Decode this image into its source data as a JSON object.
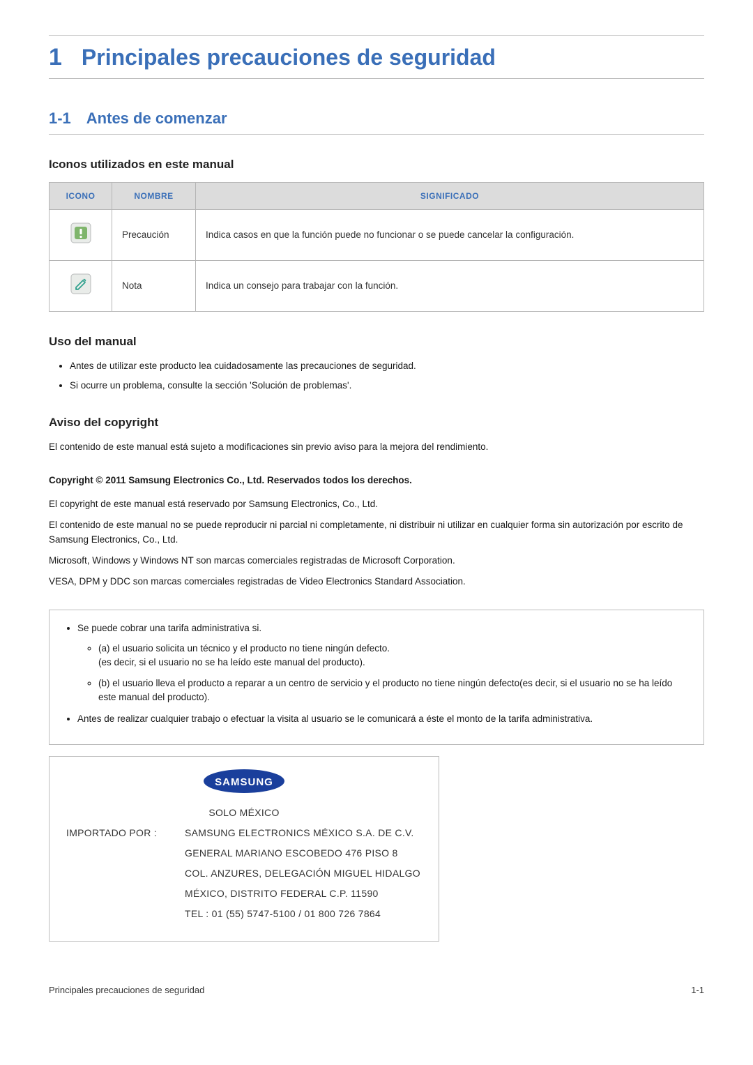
{
  "chapter": {
    "number": "1",
    "title": "Principales precauciones de seguridad"
  },
  "section": {
    "number": "1-1",
    "title": "Antes de comenzar"
  },
  "icons_heading": "Iconos utilizados en este manual",
  "icon_table": {
    "headers": {
      "icon": "ICONO",
      "name": "NOMBRE",
      "meaning": "SIGNIFICADO"
    },
    "rows": [
      {
        "name": "Precaución",
        "meaning": "Indica casos en que la función puede no funcionar o se puede cancelar la configuración."
      },
      {
        "name": "Nota",
        "meaning": "Indica un consejo para trabajar con la función."
      }
    ]
  },
  "use_heading": "Uso del manual",
  "use_bullets": [
    "Antes de utilizar este producto lea cuidadosamente las precauciones de seguridad.",
    "Si ocurre un problema, consulte la sección 'Solución de problemas'."
  ],
  "copyright_heading": "Aviso del copyright",
  "copyright_p1": "El contenido de este manual está sujeto a modificaciones sin previo aviso para la mejora del rendimiento.",
  "copyright_bold": "Copyright © 2011 Samsung Electronics Co., Ltd. Reservados todos los derechos.",
  "copyright_p2": "El copyright de este manual está reservado por Samsung Electronics, Co., Ltd.",
  "copyright_p3": "El contenido de este manual no se puede reproducir ni parcial ni completamente, ni distribuir ni utilizar en cualquier forma sin autorización por escrito de Samsung Electronics, Co., Ltd.",
  "copyright_p4": "Microsoft, Windows y Windows NT son marcas comerciales registradas de Microsoft Corporation.",
  "copyright_p5": "VESA, DPM y DDC son marcas comerciales registradas de Video Electronics Standard Association.",
  "fee": {
    "intro": "Se puede cobrar una tarifa administrativa si.",
    "a": "(a) el usuario solicita un técnico y el producto no tiene ningún defecto.",
    "a2": "(es decir, si el usuario no se ha leído este manual del producto).",
    "b": "(b) el usuario lleva el producto a reparar a un centro de servicio y el producto no tiene ningún defecto(es decir, si el usuario no se ha leído este manual del producto).",
    "before": "Antes de realizar cualquier trabajo o efectuar la visita al usuario se le comunicará a éste el monto de la tarifa administrativa."
  },
  "mexico": {
    "logo_text": "SAMSUNG",
    "solo": "SOLO MÉXICO",
    "importado_label": "IMPORTADO POR :",
    "importado_value": "SAMSUNG ELECTRONICS MÉXICO S.A. DE C.V.",
    "line2": "GENERAL MARIANO ESCOBEDO 476 PISO 8",
    "line3": "COL. ANZURES, DELEGACIÓN MIGUEL HIDALGO",
    "line4": "MÉXICO, DISTRITO FEDERAL C.P. 11590",
    "line5": "TEL : 01 (55) 5747-5100 / 01 800 726 7864"
  },
  "footer": {
    "left": "Principales precauciones de seguridad",
    "right": "1-1"
  }
}
